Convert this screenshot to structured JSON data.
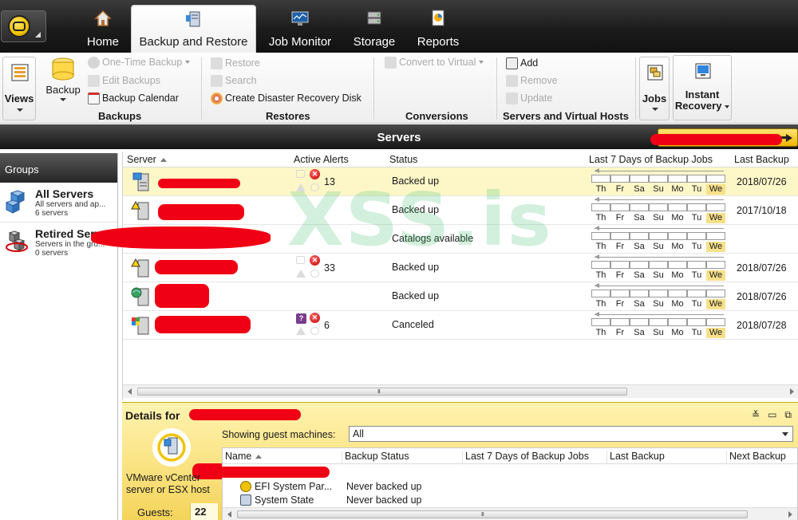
{
  "tabs": [
    {
      "label": "Home",
      "icon": "house-icon"
    },
    {
      "label": "Backup and Restore",
      "icon": "server-backup-icon"
    },
    {
      "label": "Job Monitor",
      "icon": "monitor-icon"
    },
    {
      "label": "Storage",
      "icon": "storage-icon"
    },
    {
      "label": "Reports",
      "icon": "report-icon"
    }
  ],
  "ribbon": {
    "views_label": "Views",
    "backup_label": "Backup",
    "one_time_backup": "One-Time Backup",
    "edit_backups": "Edit Backups",
    "backup_calendar": "Backup Calendar",
    "backups_group": "Backups",
    "restore": "Restore",
    "search": "Search",
    "create_dr_disk": "Create Disaster Recovery Disk",
    "restores_group": "Restores",
    "convert_to_virtual": "Convert to Virtual",
    "conversions_group": "Conversions",
    "add": "Add",
    "remove": "Remove",
    "update": "Update",
    "servers_vhosts_group": "Servers and Virtual Hosts",
    "jobs_label": "Jobs",
    "instant_recovery_line1": "Instant",
    "instant_recovery_line2": "Recovery"
  },
  "servers_bar": {
    "title": "Servers"
  },
  "groups": {
    "header": "Groups",
    "items": [
      {
        "title": "All Servers",
        "subtitle": "All servers and ap...",
        "count": "6 servers"
      },
      {
        "title": "Retired Serv...",
        "subtitle": "Servers in the gro...",
        "count": "0 servers"
      }
    ]
  },
  "table": {
    "columns": {
      "server": "Server",
      "alerts": "Active Alerts",
      "status": "Status",
      "last7": "Last 7 Days of Backup Jobs",
      "last_backup": "Last Backup"
    },
    "day_labels": [
      "Th",
      "Fr",
      "Sa",
      "Su",
      "Mo",
      "Tu",
      "We"
    ],
    "rows": [
      {
        "alerts": "13",
        "status": "Backed up",
        "last_backup": "2018/07/26"
      },
      {
        "alerts": "",
        "status": "Backed up",
        "last_backup": "2017/10/18"
      },
      {
        "alerts": "",
        "status": "Catalogs available",
        "last_backup": ""
      },
      {
        "alerts": "33",
        "status": "Backed up",
        "last_backup": "2018/07/26"
      },
      {
        "alerts": "",
        "status": "Backed up",
        "last_backup": "2018/07/26"
      },
      {
        "alerts": "6",
        "status": "Canceled",
        "last_backup": "2018/07/28"
      }
    ],
    "scroll_grip": "III"
  },
  "details": {
    "title": "Details for",
    "host_caption": "VMware vCenter server or ESX host",
    "guests_label": "Guests:",
    "guests_value": "22",
    "filter_label": "Showing guest machines:",
    "filter_value": "All",
    "columns": {
      "name": "Name",
      "backup_status": "Backup Status",
      "last7": "Last 7 Days of Backup Jobs",
      "last_backup": "Last Backup",
      "next_backup": "Next Backup"
    },
    "rows": [
      {
        "name": "EFI System Par...",
        "status": "Never backed up"
      },
      {
        "name": "System State",
        "status": "Never backed up"
      }
    ]
  },
  "watermark": "XSS.is"
}
